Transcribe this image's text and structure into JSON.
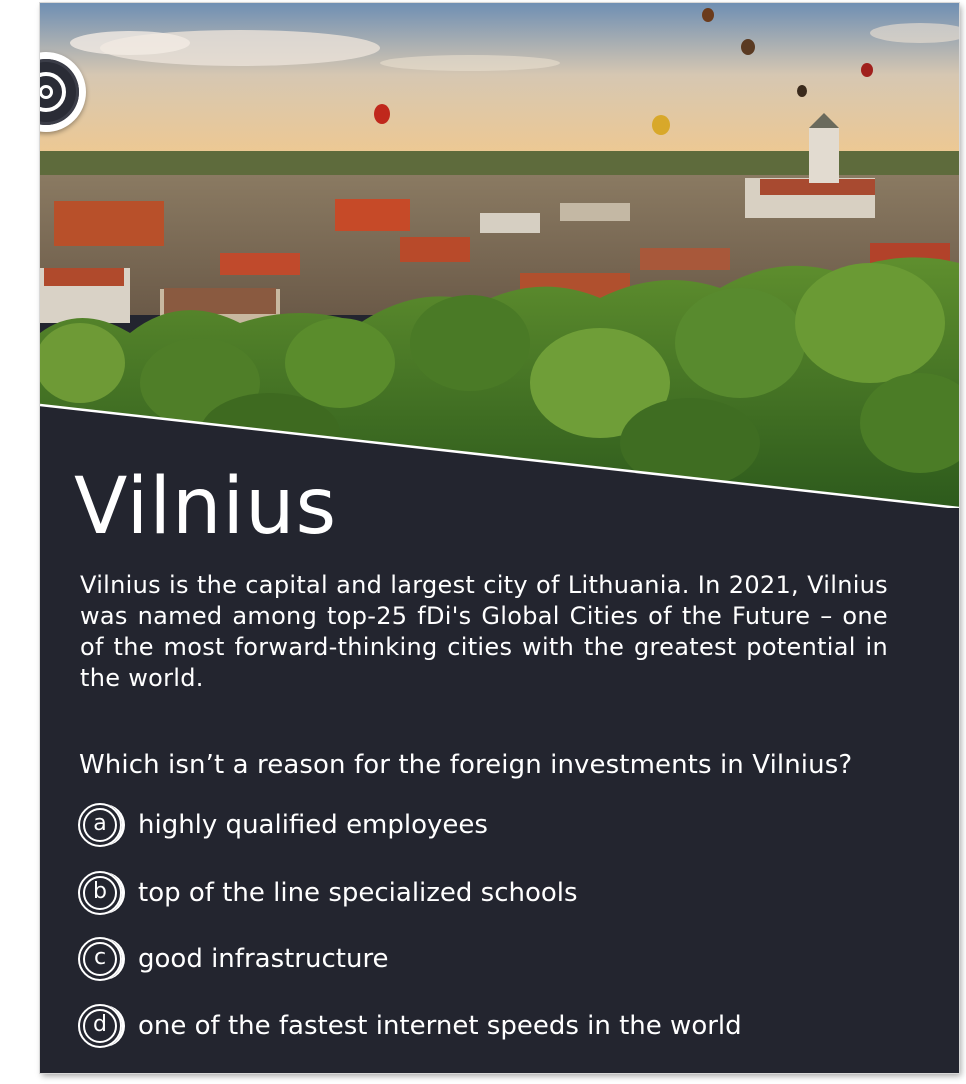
{
  "card": {
    "title": "Vilnius",
    "description": "Vilnius is the capital and largest city of Lithuania. In 2021, Vilnius was named among top-25 fDi's Global Cities of the Future – one of the most forward-thinking cities with the greatest potential in the world.",
    "question": "Which isn’t a reason for the foreign investments in Vilnius?",
    "answers": [
      {
        "letter": "a",
        "text": "highly qualified employees"
      },
      {
        "letter": "b",
        "text": "top of the line specialized schools"
      },
      {
        "letter": "c",
        "text": "good infrastructure"
      },
      {
        "letter": "d",
        "text": "one of the fastest internet speeds in the world"
      }
    ],
    "badge_icon": "target-icon",
    "colors": {
      "panel": "#23252f",
      "text": "#ffffff",
      "accent": "#ffffff"
    }
  }
}
